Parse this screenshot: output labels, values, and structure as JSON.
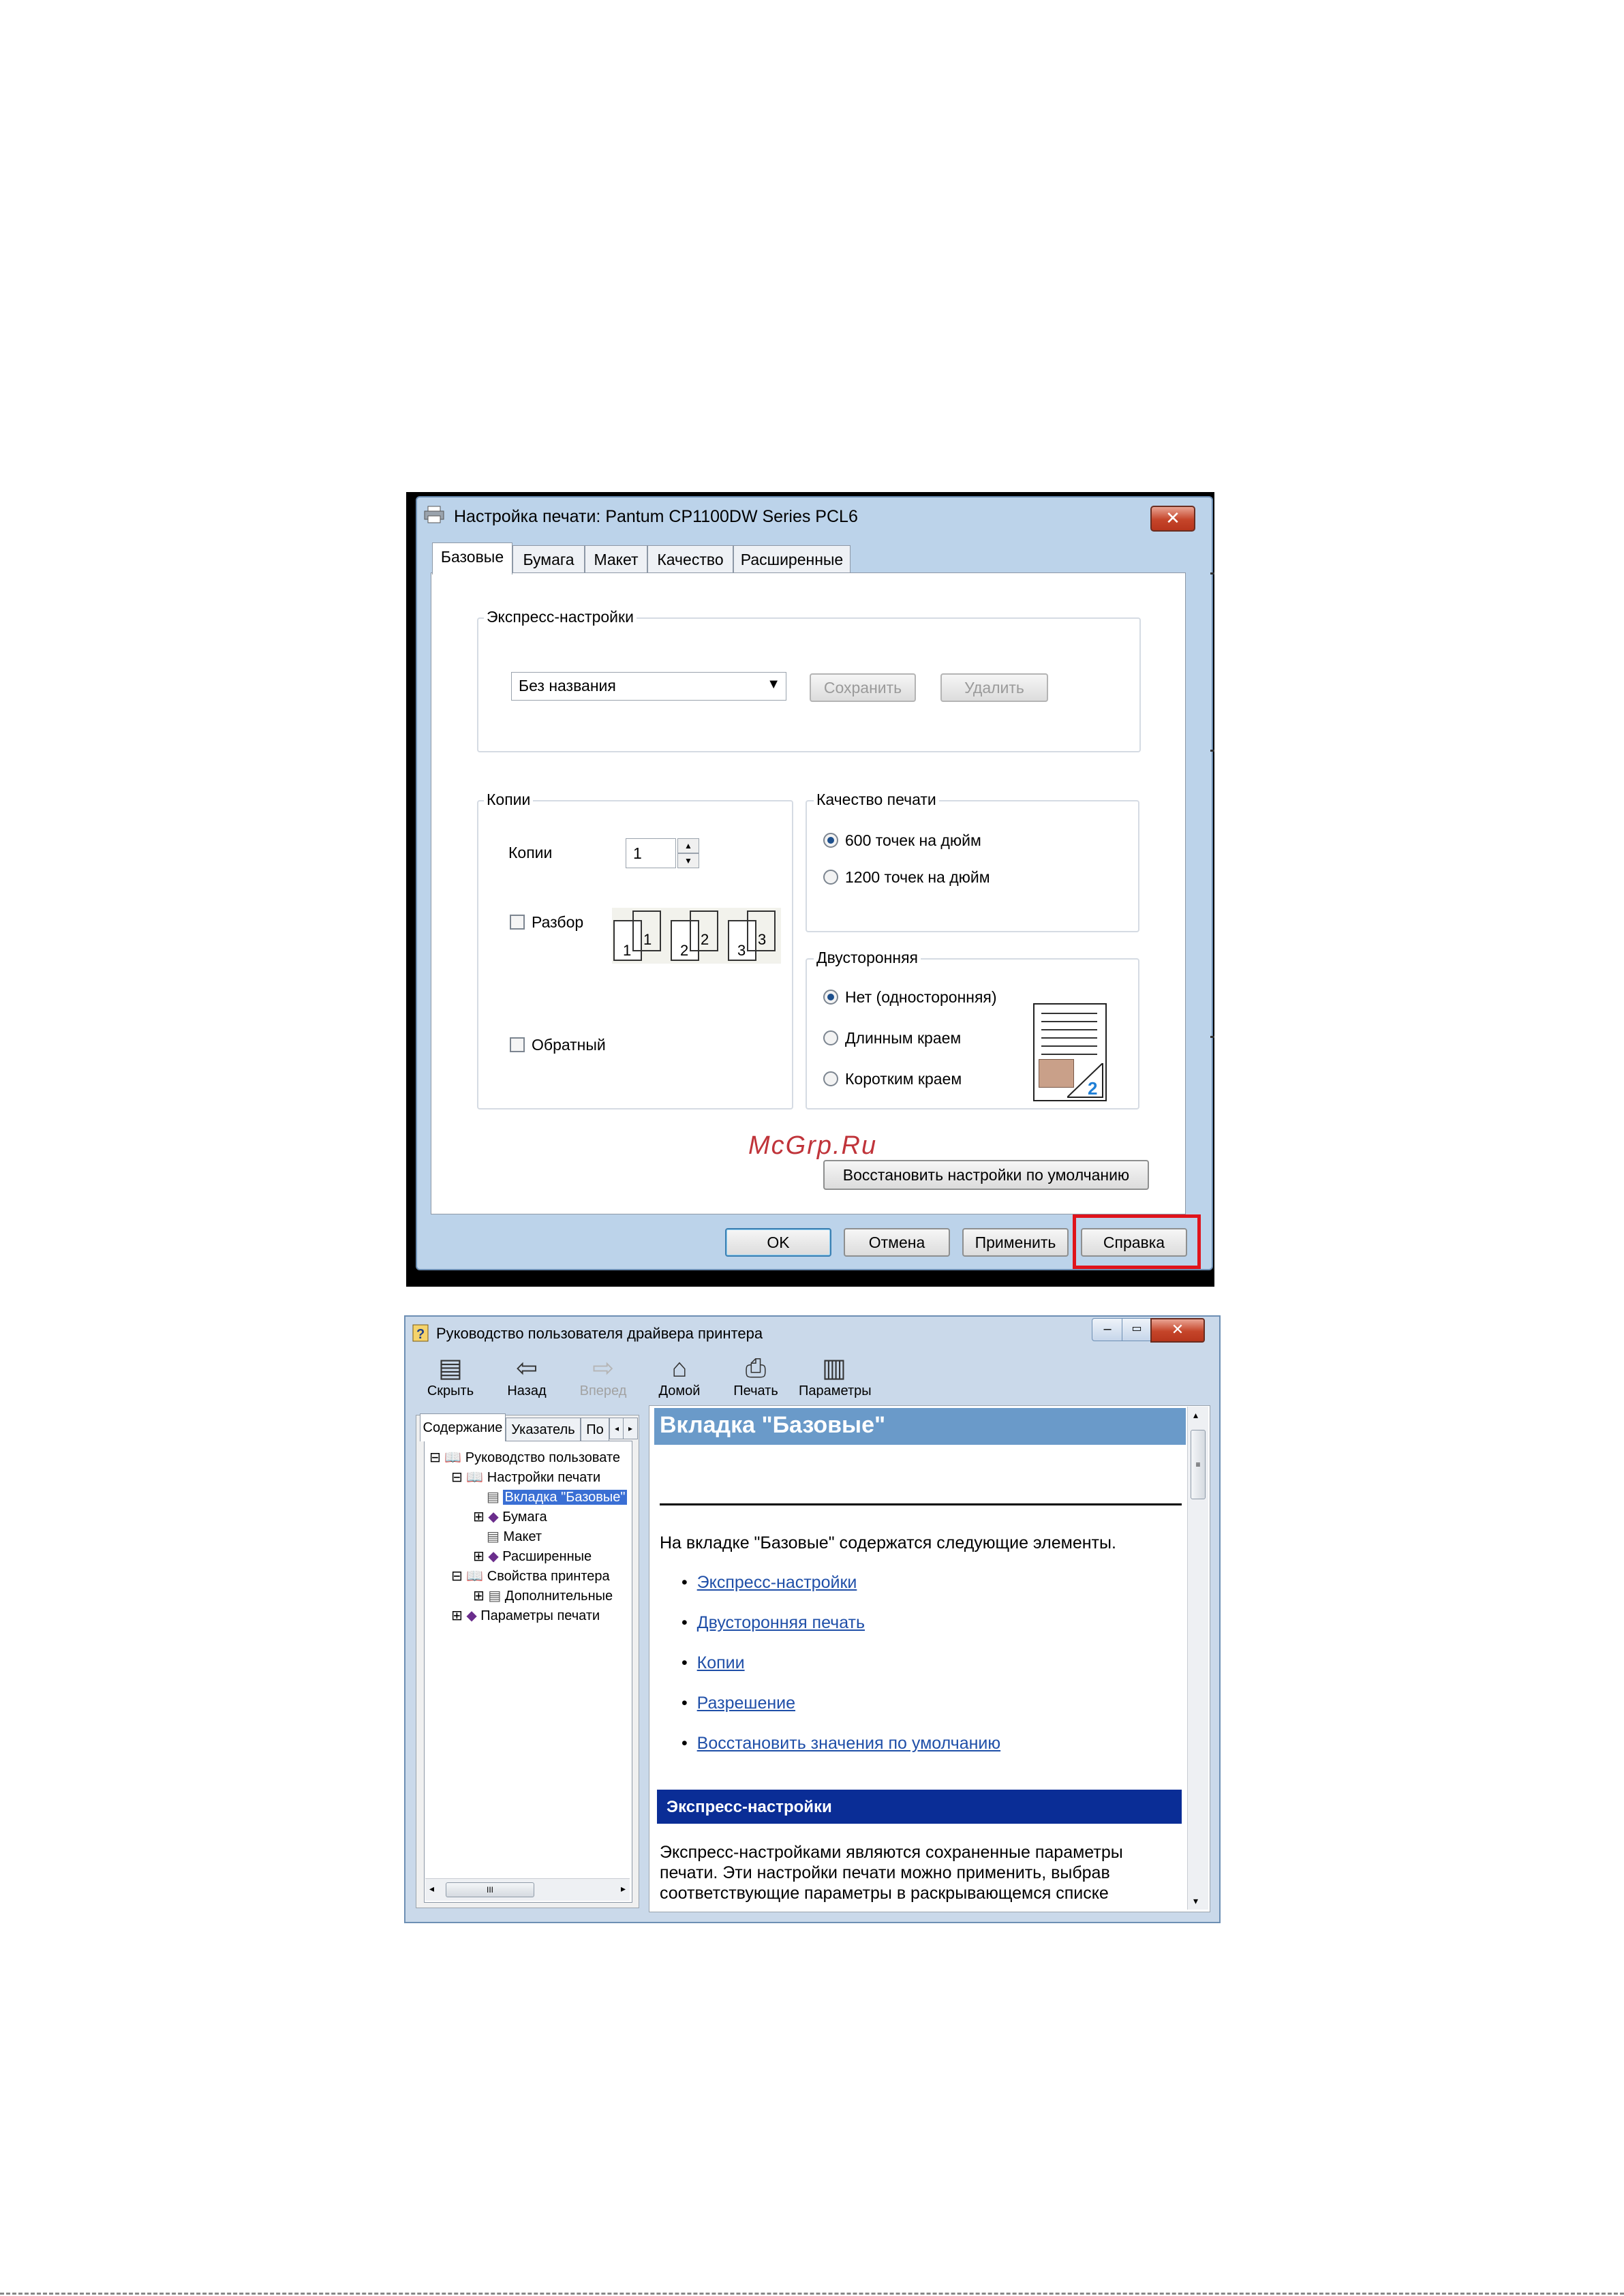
{
  "print_dialog": {
    "title": "Настройка печати: Pantum CP1100DW Series PCL6",
    "close": "✕",
    "tabs": [
      "Базовые",
      "Бумага",
      "Макет",
      "Качество",
      "Расширенные"
    ],
    "express": {
      "legend": "Экспресс-настройки",
      "select_value": "Без названия",
      "save": "Сохранить",
      "delete": "Удалить"
    },
    "copies": {
      "legend": "Копии",
      "label": "Копии",
      "value": "1",
      "collate": "Разбор",
      "reverse": "Обратный",
      "collate_pages": [
        "1",
        "1",
        "2",
        "2",
        "3",
        "3"
      ]
    },
    "quality": {
      "legend": "Качество печати",
      "options": [
        "600 точек на дюйм",
        "1200 точек на дюйм"
      ],
      "selected": 0
    },
    "duplex": {
      "legend": "Двусторонняя",
      "options": [
        "Нет (односторонняя)",
        "Длинным краем",
        "Коротким краем"
      ],
      "selected": 0,
      "preview_number": "2"
    },
    "watermark": "McGrp.Ru",
    "restore": "Восстановить настройки по умолчанию",
    "buttons": {
      "ok": "OK",
      "cancel": "Отмена",
      "apply": "Применить",
      "help": "Справка"
    },
    "highlight_color": "#e0131b"
  },
  "help_window": {
    "title": "Руководство пользователя драйвера принтера",
    "toolbar": [
      {
        "label": "Скрыть",
        "icon": "hide-icon"
      },
      {
        "label": "Назад",
        "icon": "back-arrow-icon"
      },
      {
        "label": "Вперед",
        "icon": "forward-arrow-icon"
      },
      {
        "label": "Домой",
        "icon": "home-icon"
      },
      {
        "label": "Печать",
        "icon": "printer-icon"
      },
      {
        "label": "Параметры",
        "icon": "options-icon"
      }
    ],
    "nav_tabs": [
      "Содержание",
      "Указатель",
      "По"
    ],
    "tree": [
      {
        "label": "Руководство пользовате",
        "level": 0,
        "expander": "⊟"
      },
      {
        "label": "Настройки печати",
        "level": 1,
        "expander": "⊟"
      },
      {
        "label": "Вкладка \"Базовые\"",
        "level": 2,
        "expander": ""
      },
      {
        "label": "Бумага",
        "level": 2,
        "expander": "⊞"
      },
      {
        "label": "Макет",
        "level": 2,
        "expander": ""
      },
      {
        "label": "Расширенные",
        "level": 2,
        "expander": "⊞"
      },
      {
        "label": "Свойства принтера",
        "level": 1,
        "expander": "⊟"
      },
      {
        "label": "Дополнительные",
        "level": 2,
        "expander": "⊞"
      },
      {
        "label": "Параметры печати",
        "level": 1,
        "expander": "⊞"
      }
    ],
    "content": {
      "heading": "Вкладка \"Базовые\"",
      "intro": "На вкладке \"Базовые\" содержатся следующие элементы.",
      "links": [
        "Экспресс-настройки",
        "Двусторонняя печать",
        "Копии",
        "Разрешение",
        "Восстановить значения по умолчанию"
      ],
      "section_heading": "Экспресс-настройки",
      "section_lines": [
        "Экспресс-настройками являются сохраненные параметры",
        "печати. Эти настройки печати можно применить, выбрав",
        "соответствующие параметры в раскрывающемся списке"
      ]
    }
  }
}
